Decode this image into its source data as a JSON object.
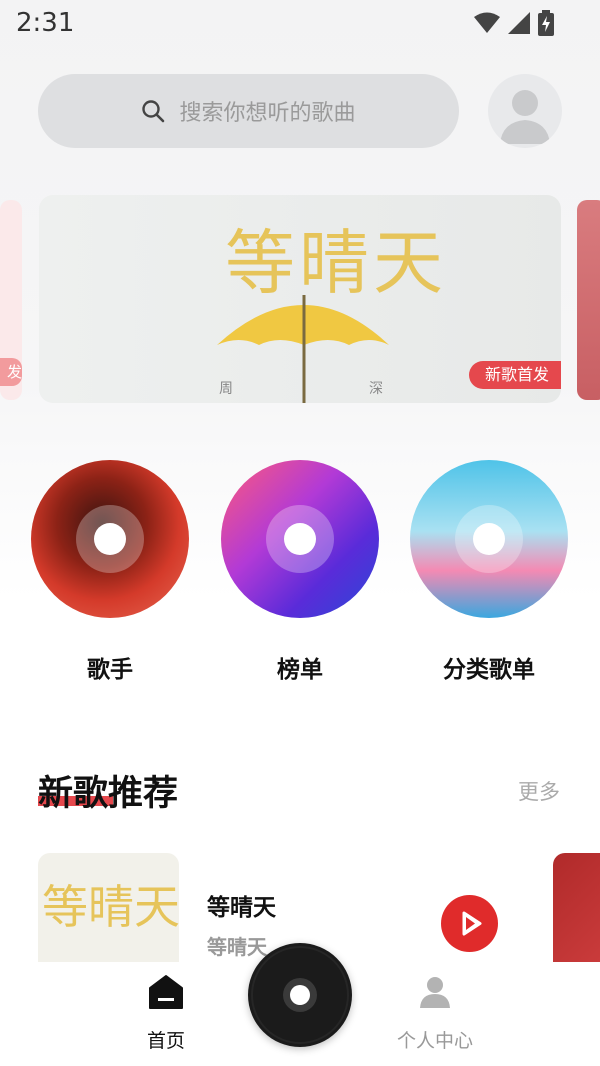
{
  "status": {
    "time": "2:31"
  },
  "search": {
    "placeholder": "搜索你想听的歌曲"
  },
  "banner": {
    "tag": "新歌首发",
    "side_tag": "发",
    "art_text": "等晴天",
    "art_names": [
      "周",
      "深"
    ]
  },
  "categories": [
    {
      "label": "歌手"
    },
    {
      "label": "榜单"
    },
    {
      "label": "分类歌单"
    }
  ],
  "section": {
    "title": "新歌推荐",
    "more": "更多"
  },
  "songs": [
    {
      "title": "等晴天",
      "artist": "等晴天"
    }
  ],
  "tabs": [
    {
      "label": "首页",
      "active": true
    },
    {
      "label": "个人中心",
      "active": false
    }
  ],
  "colors": {
    "accent": "#e5484d",
    "play": "#e02b2b",
    "record": "#1b1b1b"
  }
}
